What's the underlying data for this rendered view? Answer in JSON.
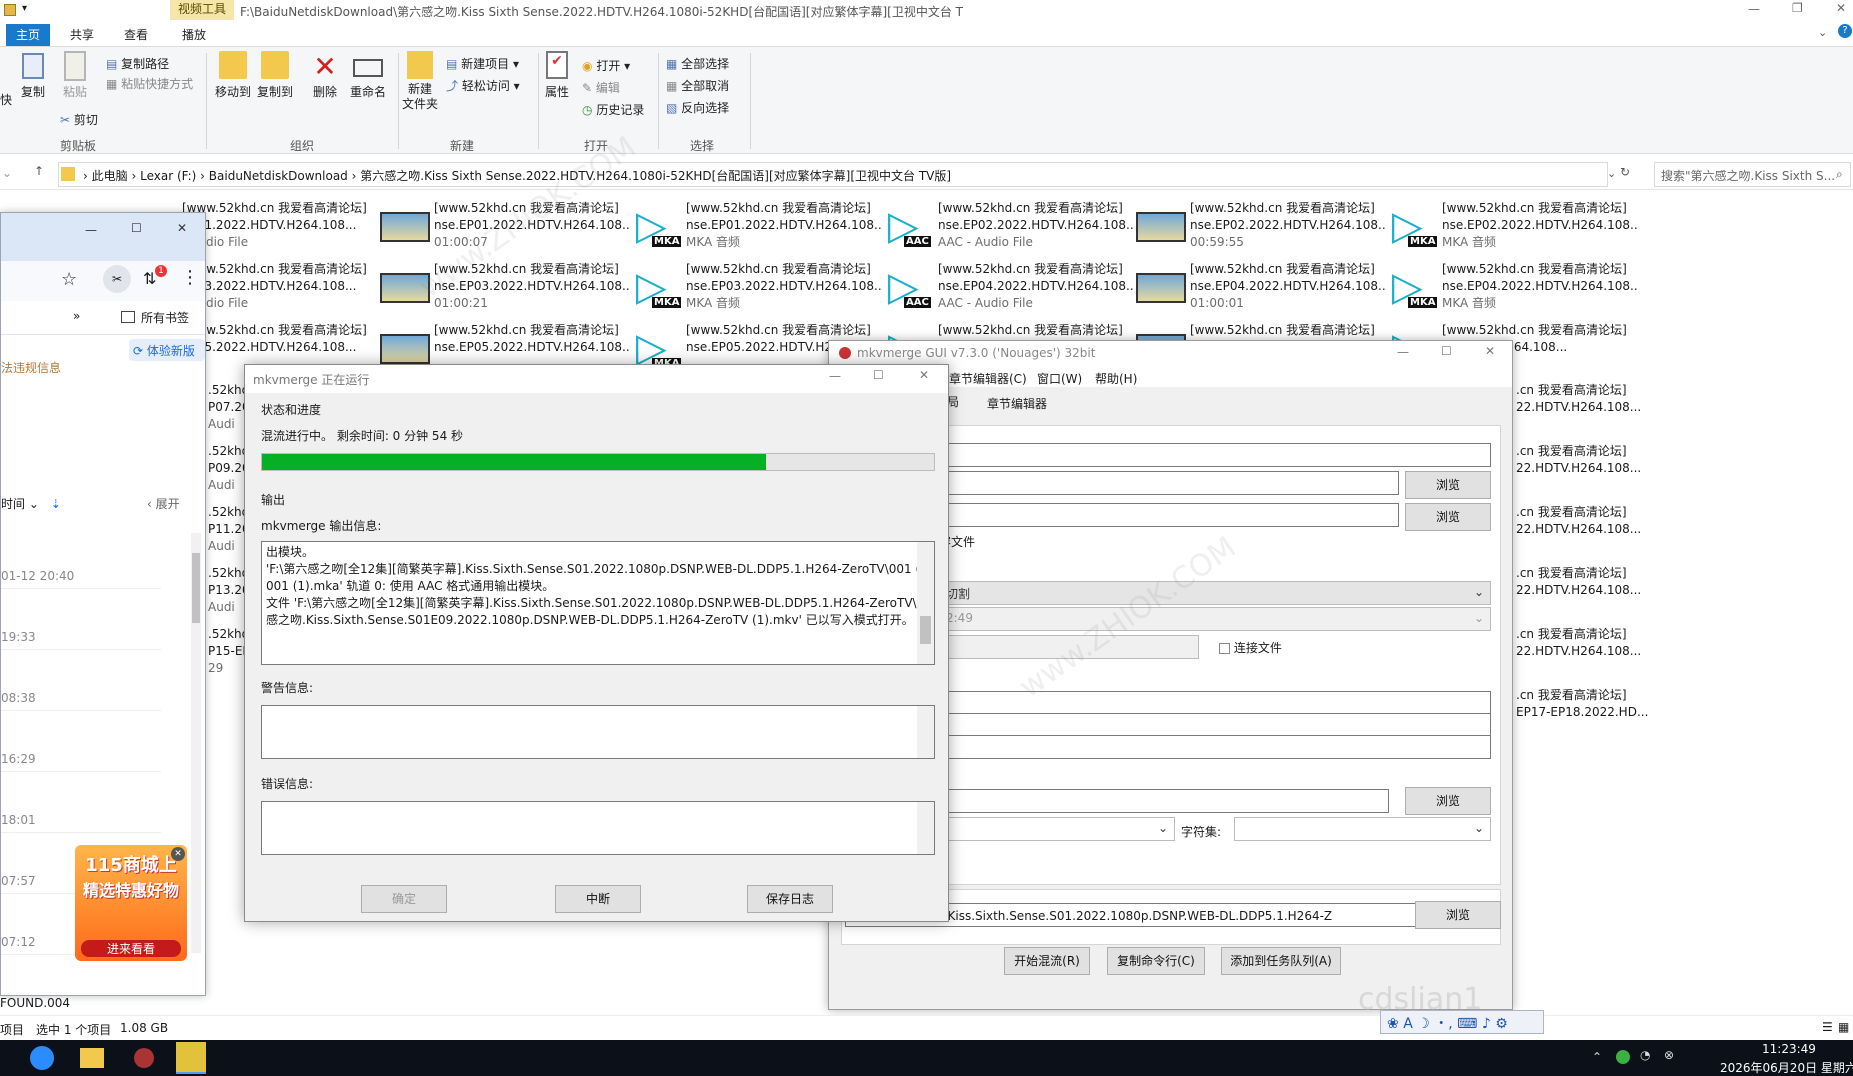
{
  "explorer": {
    "title_path": "F:\\BaiduNetdiskDownload\\第六感之吻.Kiss Sixth Sense.2022.HDTV.H264.1080i-52KHD[台配国语][对应繁体字幕][卫视中文台 T",
    "video_tools_label": "视频工具",
    "tabs": [
      "主页",
      "共享",
      "查看",
      "播放"
    ],
    "ribbon": {
      "clipboard": {
        "label": "剪贴板",
        "pin_cut": "快",
        "copy": "复制",
        "paste": "粘贴",
        "copy_path": "复制路径",
        "paste_shortcut": "粘贴快捷方式",
        "cut": "剪切"
      },
      "organize": {
        "label": "组织",
        "move_to": "移动到",
        "copy_to": "复制到",
        "delete": "删除",
        "rename": "重命名"
      },
      "new": {
        "label": "新建",
        "new_folder": "新建\n文件夹",
        "new_item": "新建项目",
        "easy_access": "轻松访问"
      },
      "open": {
        "label": "打开",
        "properties": "属性",
        "open": "打开",
        "edit": "编辑",
        "history": "历史记录"
      },
      "select": {
        "label": "选择",
        "select_all": "全部选择",
        "select_none": "全部取消",
        "invert": "反向选择"
      }
    },
    "address": {
      "crumbs": [
        "此电脑",
        "Lexar (F:)",
        "BaiduNetdiskDownload",
        "第六感之吻.Kiss Sixth Sense.2022.HDTV.H264.1080i-52KHD[台配国语][对应繁体字幕][卫视中文台 TV版]"
      ],
      "search_placeholder": "搜索\"第六感之吻.Kiss Sixth S..."
    },
    "files": [
      {
        "l1": "[www.52khd.cn 我爱看高清论坛]",
        "l2": "EP01.2022.HDTV.H264.108...",
        "l3": "- Audio File",
        "type": "aac"
      },
      {
        "l1": "[www.52khd.cn 我爱看高清论坛]",
        "l2": "nse.EP01.2022.HDTV.H264.108...",
        "l3": "01:00:07",
        "type": "video"
      },
      {
        "l1": "[www.52khd.cn 我爱看高清论坛]",
        "l2": "nse.EP01.2022.HDTV.H264.108...",
        "l3": "MKA 音频",
        "type": "mka"
      },
      {
        "l1": "[www.52khd.cn 我爱看高清论坛]",
        "l2": "nse.EP02.2022.HDTV.H264.108...",
        "l3": "AAC - Audio File",
        "type": "aac"
      },
      {
        "l1": "[www.52khd.cn 我爱看高清论坛]",
        "l2": "nse.EP02.2022.HDTV.H264.108...",
        "l3": "00:59:55",
        "type": "video"
      },
      {
        "l1": "[www.52khd.cn 我爱看高清论坛]",
        "l2": "nse.EP02.2022.HDTV.H264.108...",
        "l3": "MKA 音频",
        "type": "mka"
      },
      {
        "l1": "[www.52khd.cn 我爱看高清论坛]",
        "l2": "EP03.2022.HDTV.H264.108...",
        "l3": "- Audio File",
        "type": "aac"
      },
      {
        "l1": "[www.52khd.cn 我爱看高清论坛]",
        "l2": "nse.EP03.2022.HDTV.H264.108...",
        "l3": "01:00:21",
        "type": "video"
      },
      {
        "l1": "[www.52khd.cn 我爱看高清论坛]",
        "l2": "nse.EP03.2022.HDTV.H264.108...",
        "l3": "MKA 音频",
        "type": "mka"
      },
      {
        "l1": "[www.52khd.cn 我爱看高清论坛]",
        "l2": "nse.EP04.2022.HDTV.H264.108...",
        "l3": "AAC - Audio File",
        "type": "aac"
      },
      {
        "l1": "[www.52khd.cn 我爱看高清论坛]",
        "l2": "nse.EP04.2022.HDTV.H264.108...",
        "l3": "01:00:01",
        "type": "video"
      },
      {
        "l1": "[www.52khd.cn 我爱看高清论坛]",
        "l2": "nse.EP04.2022.HDTV.H264.108...",
        "l3": "MKA 音频",
        "type": "mka"
      },
      {
        "l1": "[www.52khd.cn 我爱看高清论坛]",
        "l2": "EP05.2022.HDTV.H264.108...",
        "l3": "",
        "type": "aac"
      },
      {
        "l1": "[www.52khd.cn 我爱看高清论坛]",
        "l2": "nse.EP05.2022.HDTV.H264.108...",
        "l3": "",
        "type": "video"
      },
      {
        "l1": "[www.52khd.cn 我爱看高清论坛]",
        "l2": "nse.EP05.2022.HDTV.H26",
        "l3": "",
        "type": "mka"
      },
      {
        "l1": "[www.52khd.cn 我爱看高清论坛]",
        "l2": "",
        "l3": "",
        "type": "aac"
      },
      {
        "l1": "[www.52khd.cn 我爱看高清论坛]",
        "l2": "",
        "l3": "",
        "type": "video"
      },
      {
        "l1": "[www.52khd.cn 我爱看高清论坛]",
        "l2": "22.HDTV.H264.108...",
        "l3": "",
        "type": "mka"
      }
    ],
    "right_column": [
      {
        "l1": ".cn 我爱看高清论坛]",
        "l2": "22.HDTV.H264.108..."
      },
      {
        "l1": ".cn 我爱看高清论坛]",
        "l2": "22.HDTV.H264.108..."
      },
      {
        "l1": ".cn 我爱看高清论坛]",
        "l2": "22.HDTV.H264.108..."
      },
      {
        "l1": ".cn 我爱看高清论坛]",
        "l2": "22.HDTV.H264.108..."
      },
      {
        "l1": ".cn 我爱看高清论坛]",
        "l2": "22.HDTV.H264.108..."
      },
      {
        "l1": ".cn 我爱看高清论坛]",
        "l2": "EP17-EP18.2022.HD..."
      }
    ],
    "left_column": [
      {
        "l1": ".52khd.",
        "l2": "P07.20",
        "l3": "Audi"
      },
      {
        "l1": ".52khd.",
        "l2": "P09.20",
        "l3": "Audi"
      },
      {
        "l1": ".52khd.",
        "l2": "P11.20",
        "l3": "Audi"
      },
      {
        "l1": ".52khd.",
        "l2": "P13.20",
        "l3": "Audi"
      },
      {
        "l1": ".52khd.",
        "l2": "P15-EI",
        "l3": "29"
      }
    ],
    "status": {
      "items": "项目",
      "selected": "选中 1 个项目",
      "size": "1.08 GB",
      "folder": "FOUND.004"
    }
  },
  "browser": {
    "bookmarks_label": "所有书签",
    "try_new": "体验新版",
    "report_text": "法违规信息",
    "sort_label": "时间",
    "expand_label": "展开",
    "times": [
      "01-12 20:40",
      "19:33",
      "08:38",
      "16:29",
      "18:01",
      "07:57",
      "07:12"
    ],
    "ad_line1": "115商城上",
    "ad_line2": "精选特惠好物",
    "ad_line3": "进来看看",
    "badge": "1"
  },
  "mkvgui": {
    "title": "mkvmerge GUI v7.3.0 ('Nouages') 32bit",
    "menu": [
      "章节编辑器(C)",
      "窗口(W)",
      "帮助(H)"
    ],
    "tabs": [
      "局",
      "章节编辑器"
    ],
    "browse": "浏览",
    "compat_label": "容文件",
    "split_select": "切割",
    "time_field": "2:49",
    "link_files": "连接文件",
    "charset_label": "字符集:",
    "output_path": "2集][简繁英字幕].Kiss.Sixth.Sense.S01.2022.1080p.DSNP.WEB-DL.DDP5.1.H264-Z",
    "start_mux": "开始混流(R)",
    "copy_cmd": "复制命令行(C)",
    "add_queue": "添加到任务队列(A)"
  },
  "progress": {
    "title": "mkvmerge 正在运行",
    "group_status": "状态和进度",
    "status_text": "混流进行中。 剩余时间: 0 分钟 54 秒",
    "percent": 75,
    "group_output": "输出",
    "output_label": "mkvmerge 输出信息:",
    "output_lines": [
      "出模块。",
      "'F:\\第六感之吻[全12集][简繁英字幕].Kiss.Sixth.Sense.S01.2022.1080p.DSNP.WEB-DL.DDP5.1.H264-ZeroTV\\001 (1)-",
      "001 (1).mka' 轨道 0: 使用 AAC 格式通用输出模块。",
      "文件 'F:\\第六感之吻[全12集][简繁英字幕].Kiss.Sixth.Sense.S01.2022.1080p.DSNP.WEB-DL.DDP5.1.H264-ZeroTV\\第六",
      "感之吻.Kiss.Sixth.Sense.S01E09.2022.1080p.DSNP.WEB-DL.DDP5.1.H264-ZeroTV (1).mkv' 已以写入模式打开。"
    ],
    "warnings_label": "警告信息:",
    "errors_label": "错误信息:",
    "ok": "确定",
    "abort": "中断",
    "save_log": "保存日志"
  },
  "taskbar": {
    "time": "11:23:49",
    "date": "2026年06月20日 星期六",
    "ime_text": "cdslian1"
  },
  "colors": {
    "accent": "#1979ca",
    "progress_green": "#06b025",
    "taskbar": "#0c1018"
  }
}
